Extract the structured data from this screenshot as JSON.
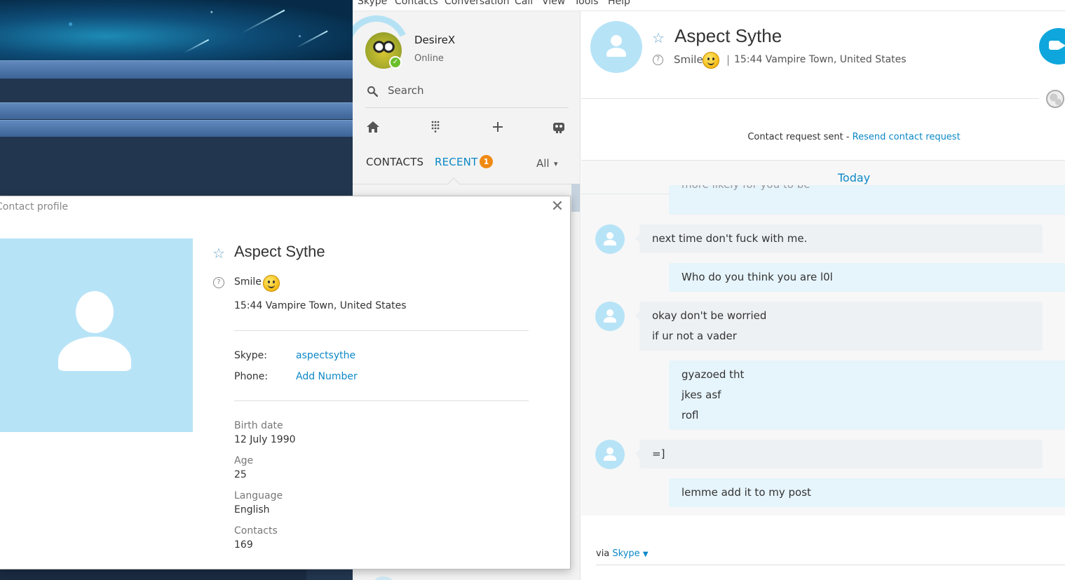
{
  "menu": [
    "Skype",
    "Contacts",
    "Conversation",
    "Call",
    "View",
    "Tools",
    "Help"
  ],
  "me": {
    "name": "DesireX",
    "status": "Online"
  },
  "search": {
    "label": "Search"
  },
  "tabs": {
    "contacts": "CONTACTS",
    "recent": "RECENT",
    "recent_badge": "1",
    "filter": "All"
  },
  "conversation": {
    "name": "Aspect Sythe",
    "mood": "Smile",
    "separator": "|",
    "location": "15:44 Vampire Town, United States",
    "request_text": "Contact request sent - ",
    "request_link": "Resend contact request",
    "day_label": "Today",
    "faded_message": "more likely for you to be",
    "messages": [
      {
        "direction": "in",
        "lines": [
          "next time don't fuck with me."
        ]
      },
      {
        "direction": "out",
        "lines": [
          "Who do you think you are l0l"
        ]
      },
      {
        "direction": "in",
        "lines": [
          "okay don't be worried",
          "if ur not a vader"
        ]
      },
      {
        "direction": "out",
        "lines": [
          "gyazoed tht",
          "jkes asf",
          "rofl"
        ]
      },
      {
        "direction": "in",
        "lines": [
          "=]"
        ]
      },
      {
        "direction": "out",
        "lines": [
          "lemme add it to my post"
        ]
      }
    ],
    "via_text": "via ",
    "via_link": "Skype"
  },
  "profile": {
    "title": "Contact profile",
    "name": "Aspect Sythe",
    "mood": "Smile",
    "location": "15:44 Vampire Town, United States",
    "skype_key": "Skype:",
    "skype_value": "aspectsythe",
    "phone_key": "Phone:",
    "phone_value": "Add Number",
    "details": [
      {
        "label": "Birth date",
        "value": "12 July 1990"
      },
      {
        "label": "Age",
        "value": "25"
      },
      {
        "label": "Language",
        "value": "English"
      },
      {
        "label": "Contacts",
        "value": "169"
      }
    ]
  },
  "icons": {
    "search": "search-icon",
    "home": "home-icon",
    "dialpad": "dialpad-icon",
    "add": "plus-icon",
    "bot": "bot-icon",
    "video": "video-call-icon",
    "globe": "globe-icon"
  },
  "colors": {
    "accent": "#0c88c6",
    "badge": "#f08a13",
    "presence": "#6abf2a",
    "avatar_bg": "#b7e3f7"
  }
}
